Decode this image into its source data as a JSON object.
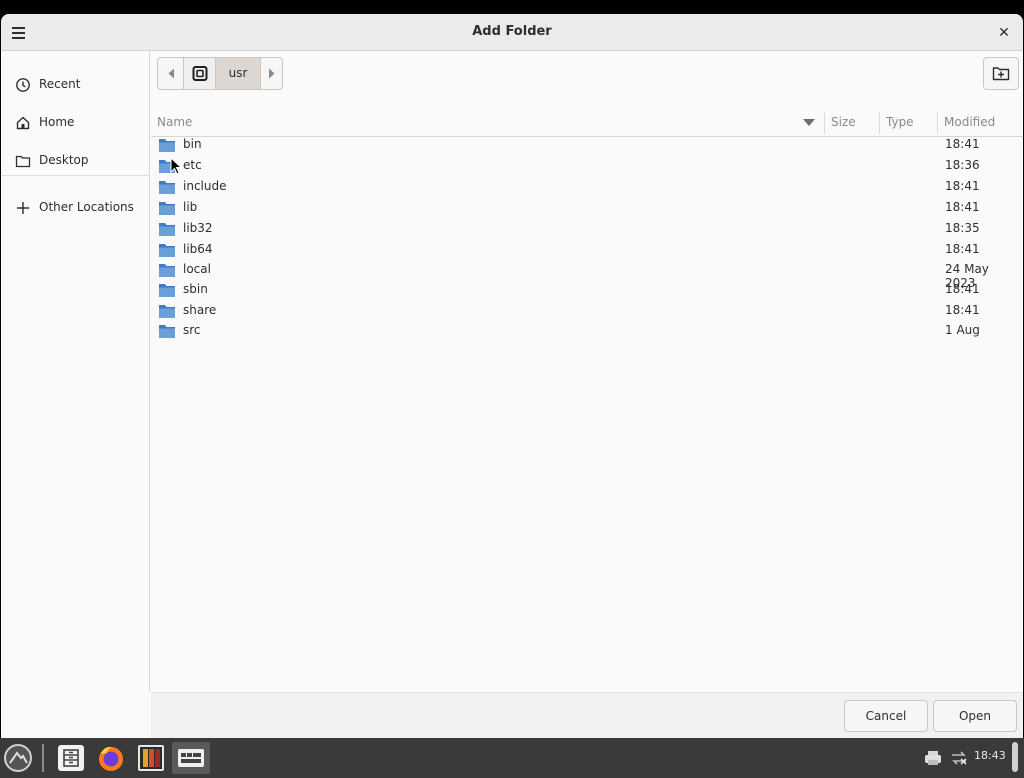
{
  "dialog": {
    "title": "Add Folder",
    "close_glyph": "✕"
  },
  "sidebar": {
    "items": [
      {
        "label": "Recent",
        "icon": "clock-icon"
      },
      {
        "label": "Home",
        "icon": "home-icon"
      },
      {
        "label": "Desktop",
        "icon": "folder-icon"
      },
      {
        "label": "Other Locations",
        "icon": "plus-icon"
      }
    ]
  },
  "path_bar": {
    "segments": [
      "usr"
    ]
  },
  "columns": {
    "name": "Name",
    "size": "Size",
    "type": "Type",
    "modified": "Modified"
  },
  "files": [
    {
      "name": "bin",
      "modified": "18:41"
    },
    {
      "name": "etc",
      "modified": "18:36"
    },
    {
      "name": "include",
      "modified": "18:41"
    },
    {
      "name": "lib",
      "modified": "18:41"
    },
    {
      "name": "lib32",
      "modified": "18:35"
    },
    {
      "name": "lib64",
      "modified": "18:41"
    },
    {
      "name": "local",
      "modified": "24 May 2023"
    },
    {
      "name": "sbin",
      "modified": "18:41"
    },
    {
      "name": "share",
      "modified": "18:41"
    },
    {
      "name": "src",
      "modified": "1 Aug"
    }
  ],
  "footer": {
    "cancel_label": "Cancel",
    "open_label": "Open"
  },
  "taskbar": {
    "clock": "18:43"
  },
  "colors": {
    "folder": "#6a9fd8",
    "folder_dark": "#3f7cc4"
  }
}
